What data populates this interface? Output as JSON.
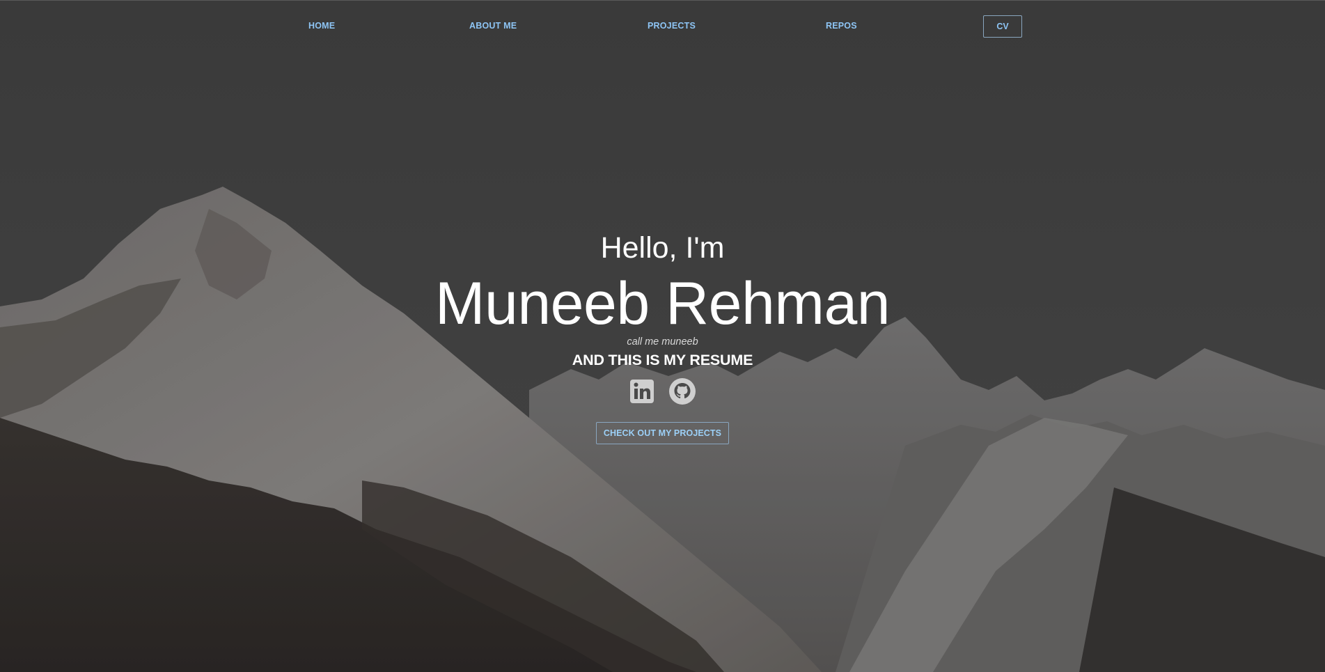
{
  "nav": {
    "home": "HOME",
    "about": "ABOUT ME",
    "projects": "PROJECTS",
    "repos": "REPOS",
    "cv": "CV"
  },
  "hero": {
    "greeting": "Hello, I'm",
    "name": "Muneeb Rehman",
    "nickname": "call me muneeb",
    "tagline": "AND THIS IS MY RESUME",
    "cta_label": "CHECK OUT MY PROJECTS"
  },
  "socials": [
    {
      "icon": "linkedin-icon"
    },
    {
      "icon": "github-icon"
    }
  ],
  "colors": {
    "link": "#8ec5f5",
    "border": "#8aa7c0",
    "overlay": "#454545",
    "text": "#ffffff"
  }
}
